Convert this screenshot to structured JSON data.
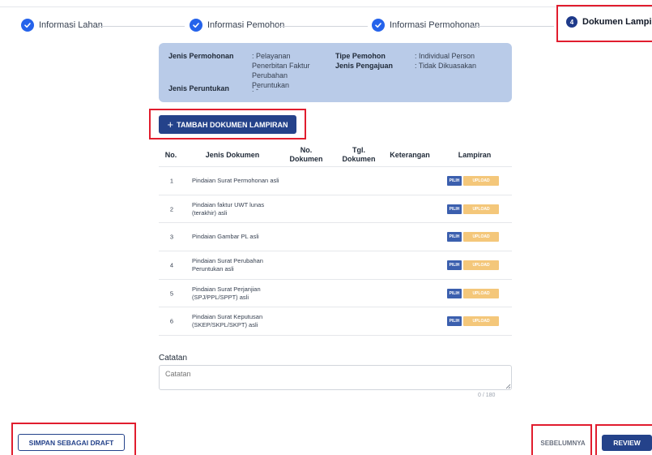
{
  "stepper": {
    "steps": [
      {
        "label": "Informasi Lahan",
        "status": "done"
      },
      {
        "label": "Informasi Pemohon",
        "status": "done"
      },
      {
        "label": "Informasi Permohonan",
        "status": "done"
      },
      {
        "label": "Dokumen Lampiran",
        "status": "active",
        "number": "4"
      }
    ]
  },
  "info": {
    "jenis_permohonan_label": "Jenis Permohonan",
    "jenis_permohonan_value": ": Pelayanan Penerbitan Faktur Perubahan Peruntukan",
    "tipe_pemohon_label": "Tipe Pemohon",
    "tipe_pemohon_value": ": Individual Person",
    "jenis_pengajuan_label": "Jenis Pengajuan",
    "jenis_pengajuan_value": ": Tidak Dikuasakan",
    "jenis_peruntukan_label": "Jenis Peruntukan",
    "jenis_peruntukan_value": ": -"
  },
  "add_button_label": "TAMBAH DOKUMEN LAMPIRAN",
  "table": {
    "headers": {
      "no": "No.",
      "jenis_dokumen": "Jenis Dokumen",
      "no_dokumen": "No. Dokumen",
      "tgl_dokumen": "Tgl. Dokumen",
      "keterangan": "Keterangan",
      "lampiran": "Lampiran"
    },
    "rows": [
      {
        "no": "1",
        "jenis": "Pindaian Surat Permohonan asli",
        "pilih": "PILIH",
        "upload": "UPLOAD"
      },
      {
        "no": "2",
        "jenis": "Pindaian faktur UWT lunas (terakhir) asli",
        "pilih": "PILIH",
        "upload": "UPLOAD"
      },
      {
        "no": "3",
        "jenis": "Pindaian Gambar PL asli",
        "pilih": "PILIH",
        "upload": "UPLOAD"
      },
      {
        "no": "4",
        "jenis": "Pindaian Surat Perubahan Peruntukan asli",
        "pilih": "PILIH",
        "upload": "UPLOAD"
      },
      {
        "no": "5",
        "jenis": "Pindaian Surat Perjanjian (SPJ/PPL/SPPT) asli",
        "pilih": "PILIH",
        "upload": "UPLOAD"
      },
      {
        "no": "6",
        "jenis": "Pindaian Surat Keputusan (SKEP/SKPL/SKPT) asli",
        "pilih": "PILIH",
        "upload": "UPLOAD"
      }
    ]
  },
  "catatan": {
    "label": "Catatan",
    "placeholder": "Catatan",
    "value": "",
    "counter": "0 / 180"
  },
  "footer": {
    "draft_label": "SIMPAN SEBAGAI DRAFT",
    "prev_label": "SEBELUMNYA",
    "review_label": "REVIEW"
  },
  "colors": {
    "primary": "#24428a",
    "check": "#2563eb",
    "highlight": "#e11d2e",
    "info_bg": "#b9cbe8",
    "upload": "#f4c77a"
  }
}
